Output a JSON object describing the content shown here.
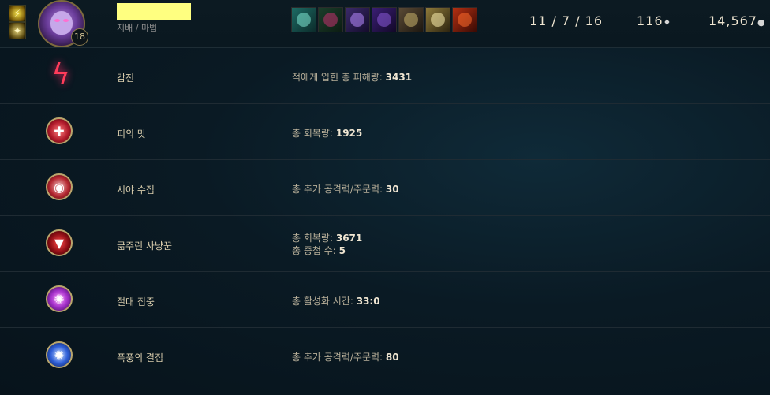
{
  "header": {
    "champion_level": "18",
    "subtitle": "지배 / 마법",
    "kda": "11 / 7 / 16",
    "cs": "116",
    "gold": "14,567",
    "summoner_spells": [
      "flash-spell-icon",
      "ignite-spell-icon"
    ],
    "items": [
      "item-1-icon",
      "item-2-icon",
      "item-3-icon",
      "item-4-icon",
      "item-5-icon",
      "item-6-icon",
      "trinket-icon"
    ]
  },
  "runes": [
    {
      "name": "감전",
      "stats": [
        {
          "label": "적에게 입힌 총 피해량: ",
          "value": "3431"
        }
      ]
    },
    {
      "name": "피의 맛",
      "stats": [
        {
          "label": "총 회복량: ",
          "value": "1925"
        }
      ]
    },
    {
      "name": "시야 수집",
      "stats": [
        {
          "label": "총 추가 공격력/주문력: ",
          "value": "30"
        }
      ]
    },
    {
      "name": "굶주린 사냥꾼",
      "stats": [
        {
          "label": "총 회복량: ",
          "value": "3671"
        },
        {
          "label": "총 중첩 수: ",
          "value": "5"
        }
      ]
    },
    {
      "name": "절대 집중",
      "stats": [
        {
          "label": "총 활성화 시간: ",
          "value": "33:0"
        }
      ]
    },
    {
      "name": "폭풍의 결집",
      "stats": [
        {
          "label": "총 추가 공격력/주문력: ",
          "value": "80"
        }
      ]
    }
  ]
}
